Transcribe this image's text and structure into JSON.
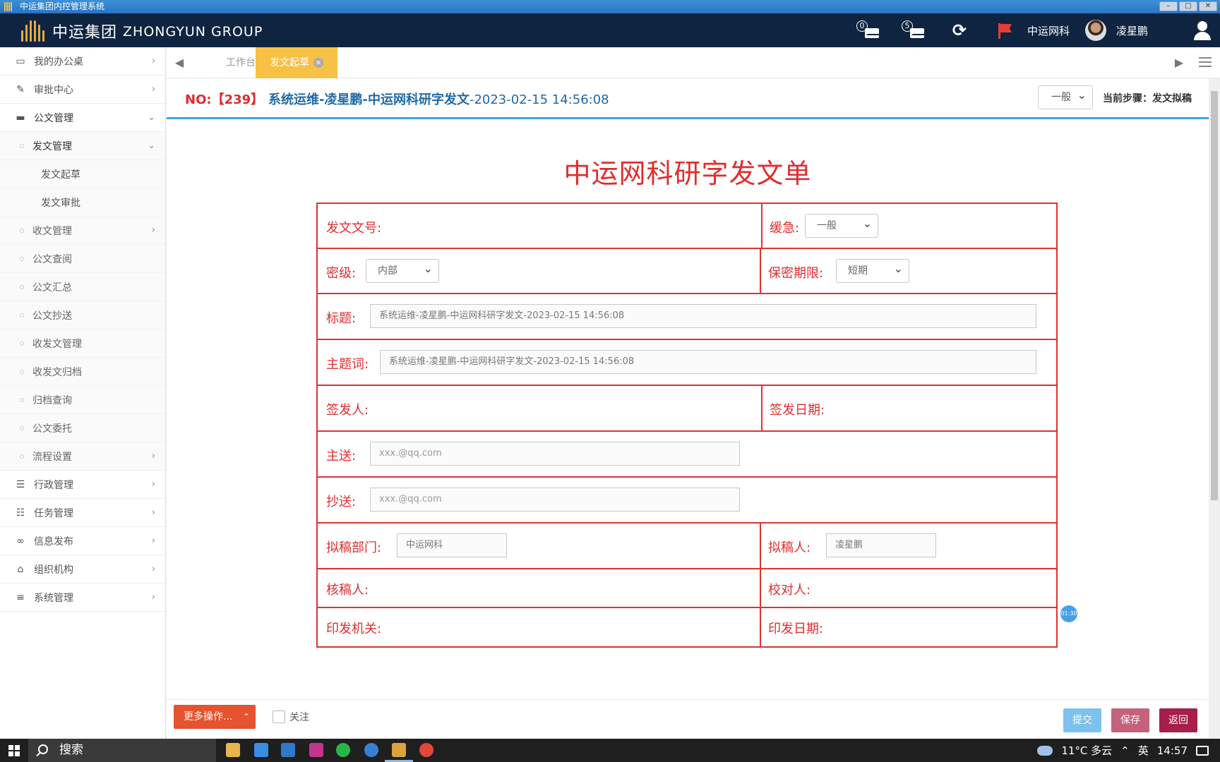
{
  "window": {
    "title": "中运集团内控管理系统",
    "controls": [
      "–",
      "□",
      "✕"
    ]
  },
  "header": {
    "logo_cn": "中运集团",
    "logo_en": "ZHONGYUN GROUP",
    "mail_count": "0",
    "todo_count": "5",
    "org_name": "中运网科",
    "user_name": "凌星鹏"
  },
  "sidebar": {
    "items": [
      {
        "label": "我的办公桌",
        "icon": "desktop-icon"
      },
      {
        "label": "审批中心",
        "icon": "edit-icon"
      },
      {
        "label": "公文管理",
        "icon": "briefcase-icon"
      },
      {
        "label": "发文管理"
      },
      {
        "label": "发文起草"
      },
      {
        "label": "发文审批"
      },
      {
        "label": "收文管理"
      },
      {
        "label": "公文查阅"
      },
      {
        "label": "公文汇总"
      },
      {
        "label": "公文抄送"
      },
      {
        "label": "收发文管理"
      },
      {
        "label": "收发文归档"
      },
      {
        "label": "归档查询"
      },
      {
        "label": "公文委托"
      },
      {
        "label": "流程设置"
      },
      {
        "label": "行政管理",
        "icon": "server-icon"
      },
      {
        "label": "任务管理",
        "icon": "tasks-icon"
      },
      {
        "label": "信息发布",
        "icon": "link-icon"
      },
      {
        "label": "组织机构",
        "icon": "bank-icon"
      },
      {
        "label": "系统管理",
        "icon": "bars-icon"
      }
    ]
  },
  "tabs": {
    "workbench": "工作台",
    "active": "发文起草"
  },
  "doc": {
    "no": "NO:【239】",
    "title_bold": "系统运维-凌星鹏-中运网科研字发文",
    "title_suffix": "-2023-02-15 14:56:08",
    "urgency": "一般",
    "step": "当前步骤：发文拟稿"
  },
  "form": {
    "heading": "中运网科研字发文单",
    "doc_number_label": "发文文号:",
    "priority_label": "缓急:",
    "priority_value": "一般",
    "secret_label": "密级:",
    "secret_value": "内部",
    "secret_period_label": "保密期限:",
    "secret_period_value": "短期",
    "subject_label": "标题:",
    "subject_value": "系统运维-凌星鹏-中运网科研字发文-2023-02-15 14:56:08",
    "keyword_label": "主题词:",
    "keyword_value": "系统运维-凌星鹏-中运网科研字发文-2023-02-15 14:56:08",
    "signer_label": "签发人:",
    "sign_date_label": "签发日期:",
    "to_label": "主送:",
    "to_placeholder": "xxx.@qq.com",
    "cc_label": "抄送:",
    "cc_placeholder": "xxx.@qq.com",
    "draft_dept_label": "拟稿部门:",
    "draft_dept_value": "中运网科",
    "drafter_label": "拟稿人:",
    "drafter_value": "凌星鹏",
    "checker_label": "核稿人:",
    "proofreader_label": "校对人:",
    "issuer_label": "印发机关:",
    "issue_date_label": "印发日期:"
  },
  "timer": "01:30",
  "bottom": {
    "more": "更多操作...",
    "follow": "关注",
    "submit": "提交",
    "save": "保存",
    "back": "返回"
  },
  "colors": {
    "submit": "#7ec0ee",
    "save": "#c4627c",
    "back": "#a51f48",
    "more": "#e5532f",
    "form_red": "#e02d2d"
  },
  "taskbar": {
    "search": "搜索",
    "weather": "11°C 多云",
    "ime": "英",
    "time": "14:57"
  }
}
